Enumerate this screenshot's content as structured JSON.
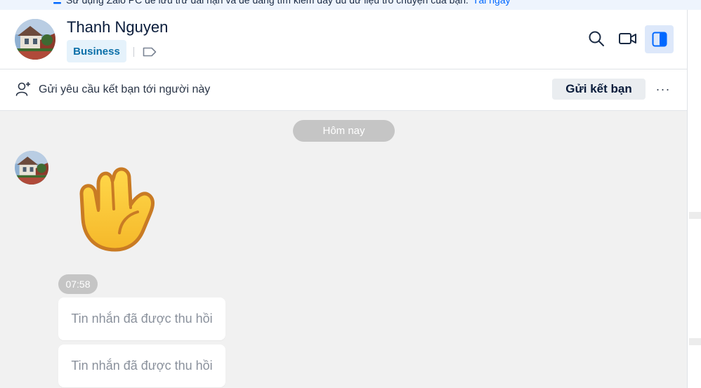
{
  "banner": {
    "text": "Sử dụng Zalo PC để lưu trữ dài hạn và dễ dàng tìm kiếm đầy đủ dữ liệu trò chuyện của bạn.",
    "link": "Tải ngay"
  },
  "header": {
    "contact_name": "Thanh Nguyen",
    "badge": "Business",
    "icons": [
      "search-icon",
      "video-call-icon",
      "toggle-panel-icon"
    ]
  },
  "friend_request": {
    "text": "Gửi yêu cầu kết bạn tới người này",
    "button_label": "Gửi kết bạn",
    "more_label": "···"
  },
  "chat": {
    "date_divider": "Hôm nay",
    "sticker": "waving-hand",
    "time": "07:58",
    "messages": [
      {
        "text": "Tin nhắn đã được thu hồi"
      },
      {
        "text": "Tin nhắn đã được thu hồi"
      }
    ]
  },
  "colors": {
    "accent": "#0068ff",
    "badge_bg": "#e5f2fb",
    "badge_text": "#0a6fa8",
    "chat_bg": "#f1f1f1"
  }
}
